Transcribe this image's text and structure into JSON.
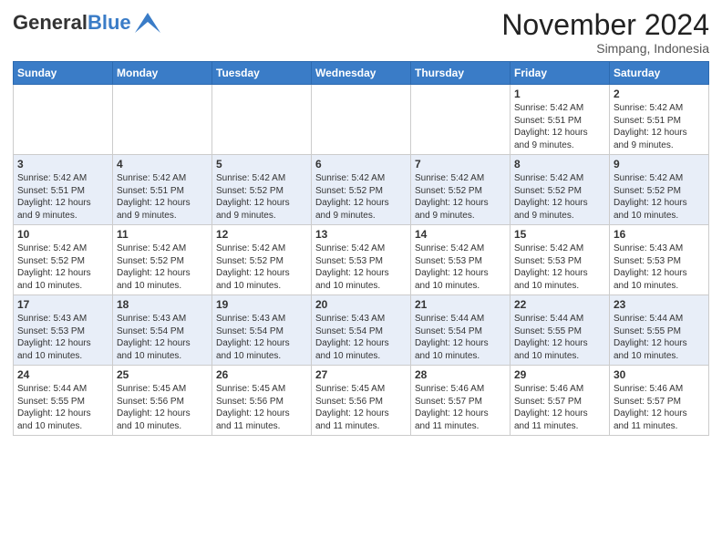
{
  "header": {
    "logo_general": "General",
    "logo_blue": "Blue",
    "month_title": "November 2024",
    "subtitle": "Simpang, Indonesia"
  },
  "weekdays": [
    "Sunday",
    "Monday",
    "Tuesday",
    "Wednesday",
    "Thursday",
    "Friday",
    "Saturday"
  ],
  "weeks": [
    {
      "days": [
        {
          "num": "",
          "info": ""
        },
        {
          "num": "",
          "info": ""
        },
        {
          "num": "",
          "info": ""
        },
        {
          "num": "",
          "info": ""
        },
        {
          "num": "",
          "info": ""
        },
        {
          "num": "1",
          "info": "Sunrise: 5:42 AM\nSunset: 5:51 PM\nDaylight: 12 hours and 9 minutes."
        },
        {
          "num": "2",
          "info": "Sunrise: 5:42 AM\nSunset: 5:51 PM\nDaylight: 12 hours and 9 minutes."
        }
      ]
    },
    {
      "days": [
        {
          "num": "3",
          "info": "Sunrise: 5:42 AM\nSunset: 5:51 PM\nDaylight: 12 hours and 9 minutes."
        },
        {
          "num": "4",
          "info": "Sunrise: 5:42 AM\nSunset: 5:51 PM\nDaylight: 12 hours and 9 minutes."
        },
        {
          "num": "5",
          "info": "Sunrise: 5:42 AM\nSunset: 5:52 PM\nDaylight: 12 hours and 9 minutes."
        },
        {
          "num": "6",
          "info": "Sunrise: 5:42 AM\nSunset: 5:52 PM\nDaylight: 12 hours and 9 minutes."
        },
        {
          "num": "7",
          "info": "Sunrise: 5:42 AM\nSunset: 5:52 PM\nDaylight: 12 hours and 9 minutes."
        },
        {
          "num": "8",
          "info": "Sunrise: 5:42 AM\nSunset: 5:52 PM\nDaylight: 12 hours and 9 minutes."
        },
        {
          "num": "9",
          "info": "Sunrise: 5:42 AM\nSunset: 5:52 PM\nDaylight: 12 hours and 10 minutes."
        }
      ]
    },
    {
      "days": [
        {
          "num": "10",
          "info": "Sunrise: 5:42 AM\nSunset: 5:52 PM\nDaylight: 12 hours and 10 minutes."
        },
        {
          "num": "11",
          "info": "Sunrise: 5:42 AM\nSunset: 5:52 PM\nDaylight: 12 hours and 10 minutes."
        },
        {
          "num": "12",
          "info": "Sunrise: 5:42 AM\nSunset: 5:52 PM\nDaylight: 12 hours and 10 minutes."
        },
        {
          "num": "13",
          "info": "Sunrise: 5:42 AM\nSunset: 5:53 PM\nDaylight: 12 hours and 10 minutes."
        },
        {
          "num": "14",
          "info": "Sunrise: 5:42 AM\nSunset: 5:53 PM\nDaylight: 12 hours and 10 minutes."
        },
        {
          "num": "15",
          "info": "Sunrise: 5:42 AM\nSunset: 5:53 PM\nDaylight: 12 hours and 10 minutes."
        },
        {
          "num": "16",
          "info": "Sunrise: 5:43 AM\nSunset: 5:53 PM\nDaylight: 12 hours and 10 minutes."
        }
      ]
    },
    {
      "days": [
        {
          "num": "17",
          "info": "Sunrise: 5:43 AM\nSunset: 5:53 PM\nDaylight: 12 hours and 10 minutes."
        },
        {
          "num": "18",
          "info": "Sunrise: 5:43 AM\nSunset: 5:54 PM\nDaylight: 12 hours and 10 minutes."
        },
        {
          "num": "19",
          "info": "Sunrise: 5:43 AM\nSunset: 5:54 PM\nDaylight: 12 hours and 10 minutes."
        },
        {
          "num": "20",
          "info": "Sunrise: 5:43 AM\nSunset: 5:54 PM\nDaylight: 12 hours and 10 minutes."
        },
        {
          "num": "21",
          "info": "Sunrise: 5:44 AM\nSunset: 5:54 PM\nDaylight: 12 hours and 10 minutes."
        },
        {
          "num": "22",
          "info": "Sunrise: 5:44 AM\nSunset: 5:55 PM\nDaylight: 12 hours and 10 minutes."
        },
        {
          "num": "23",
          "info": "Sunrise: 5:44 AM\nSunset: 5:55 PM\nDaylight: 12 hours and 10 minutes."
        }
      ]
    },
    {
      "days": [
        {
          "num": "24",
          "info": "Sunrise: 5:44 AM\nSunset: 5:55 PM\nDaylight: 12 hours and 10 minutes."
        },
        {
          "num": "25",
          "info": "Sunrise: 5:45 AM\nSunset: 5:56 PM\nDaylight: 12 hours and 10 minutes."
        },
        {
          "num": "26",
          "info": "Sunrise: 5:45 AM\nSunset: 5:56 PM\nDaylight: 12 hours and 11 minutes."
        },
        {
          "num": "27",
          "info": "Sunrise: 5:45 AM\nSunset: 5:56 PM\nDaylight: 12 hours and 11 minutes."
        },
        {
          "num": "28",
          "info": "Sunrise: 5:46 AM\nSunset: 5:57 PM\nDaylight: 12 hours and 11 minutes."
        },
        {
          "num": "29",
          "info": "Sunrise: 5:46 AM\nSunset: 5:57 PM\nDaylight: 12 hours and 11 minutes."
        },
        {
          "num": "30",
          "info": "Sunrise: 5:46 AM\nSunset: 5:57 PM\nDaylight: 12 hours and 11 minutes."
        }
      ]
    }
  ]
}
